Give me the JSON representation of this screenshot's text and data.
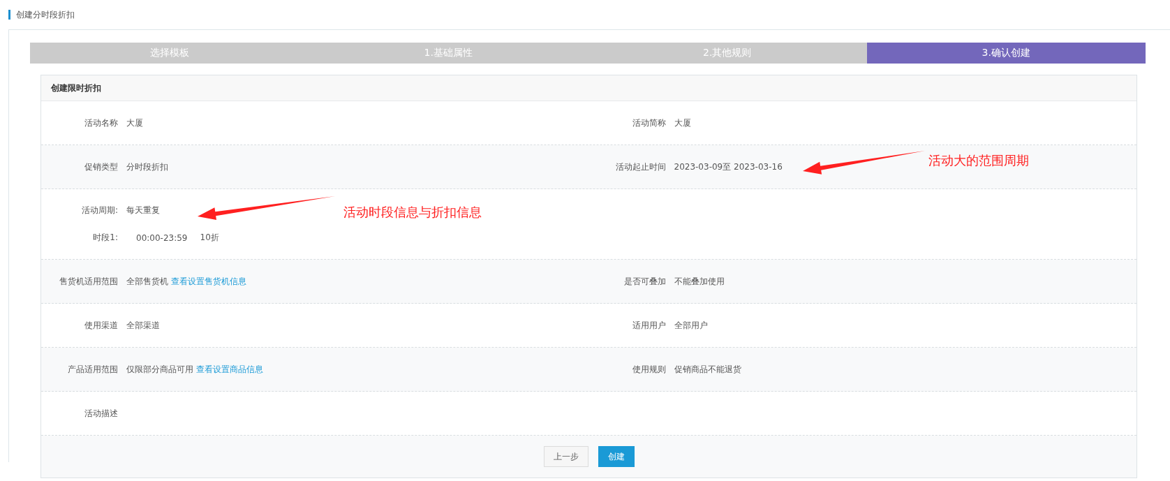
{
  "page_title": "创建分时段折扣",
  "steps": [
    {
      "label": "选择模板",
      "selected": false
    },
    {
      "label": "1.基础属性",
      "selected": false
    },
    {
      "label": "2.其他规则",
      "selected": false
    },
    {
      "label": "3.确认创建",
      "selected": true
    }
  ],
  "card": {
    "title": "创建限时折扣",
    "rows": [
      {
        "kind": "pair",
        "fields": [
          {
            "label": "活动名称",
            "value": "大厦"
          },
          {
            "label": "活动简称",
            "value": "大厦"
          }
        ]
      },
      {
        "kind": "pair",
        "fields": [
          {
            "label": "促销类型",
            "value": "分时段折扣"
          },
          {
            "label": "活动起止时间",
            "value": "2023-03-09至 2023-03-16"
          }
        ]
      },
      {
        "kind": "schedule",
        "label": "活动周期:",
        "value": "每天重复",
        "segments": [
          {
            "label": "时段1:",
            "time": "00:00-23:59",
            "discount": "10折"
          }
        ]
      },
      {
        "kind": "pair",
        "fields": [
          {
            "label": "售货机适用范围",
            "value": "全部售货机",
            "link": "查看设置售货机信息"
          },
          {
            "label": "是否可叠加",
            "value": "不能叠加使用"
          }
        ]
      },
      {
        "kind": "pair",
        "fields": [
          {
            "label": "使用渠道",
            "value": "全部渠道"
          },
          {
            "label": "适用用户",
            "value": "全部用户"
          }
        ]
      },
      {
        "kind": "pair",
        "fields": [
          {
            "label": "产品适用范围",
            "value": "仅限部分商品可用",
            "link": "查看设置商品信息"
          },
          {
            "label": "使用规则",
            "value": "促销商品不能退货"
          }
        ]
      },
      {
        "kind": "pair",
        "fields": [
          {
            "label": "活动描述"
          }
        ]
      }
    ],
    "buttons": [
      {
        "label": "上一步",
        "kind": "default"
      },
      {
        "label": "创建",
        "kind": "primary"
      }
    ]
  },
  "annotations": [
    {
      "text": "活动大的范围周期"
    },
    {
      "text": "活动时段信息与折扣信息"
    }
  ]
}
